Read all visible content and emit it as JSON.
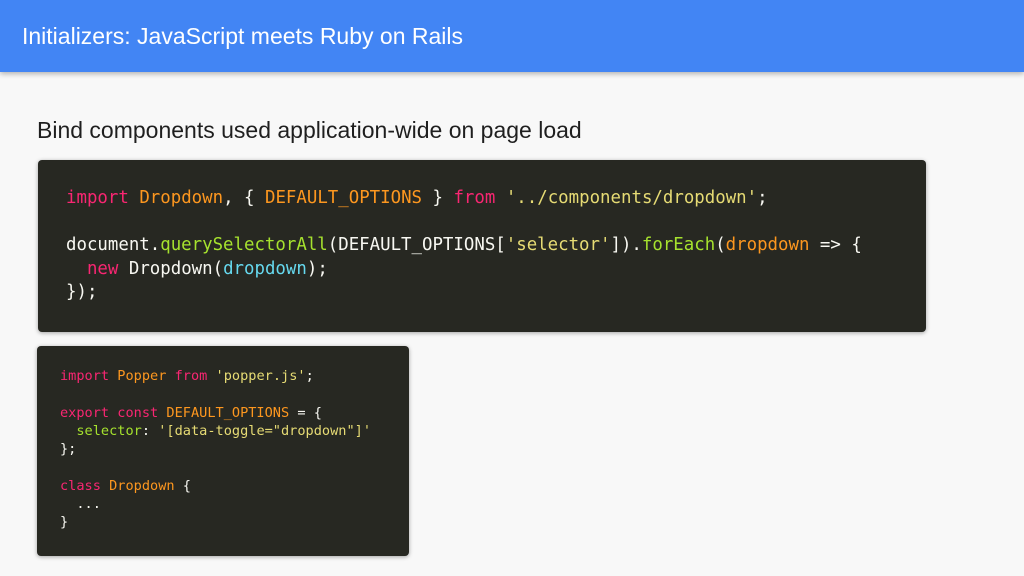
{
  "slide": {
    "title": "Initializers: JavaScript meets Ruby on Rails",
    "subtitle": "Bind components used application-wide on page load"
  },
  "code_main": {
    "line1": {
      "kw_import": "import",
      "sp1": " ",
      "default_import": "Dropdown",
      "brace_open": ", { ",
      "named_import": "DEFAULT_OPTIONS",
      "brace_close": " } ",
      "kw_from": "from",
      "sp2": " ",
      "path": "'../components/dropdown'",
      "semi": ";"
    },
    "line3": {
      "obj": "document.",
      "method1": "querySelectorAll",
      "p1": "(DEFAULT_OPTIONS[",
      "key": "'selector'",
      "p2": "]).",
      "method2": "forEach",
      "p3": "(",
      "param": "dropdown",
      "arrow": " => {"
    },
    "line4": {
      "indent": "  ",
      "kw_new": "new",
      "ctor": " Dropdown(",
      "arg": "dropdown",
      "end": ");"
    },
    "line5": "});"
  },
  "code_popper": {
    "line1": {
      "kw_import": "import",
      "sp1": " ",
      "name": "Popper",
      "sp2": " ",
      "kw_from": "from",
      "sp3": " ",
      "path": "'popper.js'",
      "semi": ";"
    },
    "line3": {
      "kw_export": "export",
      "sp1": " ",
      "kw_const": "const",
      "sp2": " ",
      "name": "DEFAULT_OPTIONS",
      "rest": " = {"
    },
    "line4": {
      "indent": "  ",
      "prop": "selector",
      "colon": ": ",
      "value": "'[data-toggle=\"dropdown\"]'"
    },
    "line5": "};",
    "line7": {
      "kw_class": "class",
      "sp1": " ",
      "name": "Dropdown",
      "rest": " {"
    },
    "line8": "  ...",
    "line9": "}"
  },
  "colors": {
    "header_bar": "#4285f4",
    "code_background": "#272822",
    "keyword": "#f92672",
    "string": "#e6db74",
    "function": "#a6e22e",
    "parameter": "#fd971f",
    "identifier": "#66d9ef"
  }
}
